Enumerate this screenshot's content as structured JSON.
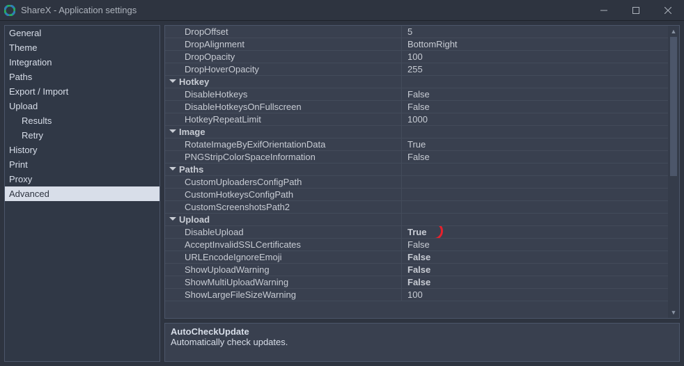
{
  "window": {
    "title": "ShareX - Application settings"
  },
  "sidebar": {
    "items": [
      {
        "label": "General",
        "indent": false
      },
      {
        "label": "Theme",
        "indent": false
      },
      {
        "label": "Integration",
        "indent": false
      },
      {
        "label": "Paths",
        "indent": false
      },
      {
        "label": "Export / Import",
        "indent": false
      },
      {
        "label": "Upload",
        "indent": false
      },
      {
        "label": "Results",
        "indent": true
      },
      {
        "label": "Retry",
        "indent": true
      },
      {
        "label": "History",
        "indent": false
      },
      {
        "label": "Print",
        "indent": false
      },
      {
        "label": "Proxy",
        "indent": false
      },
      {
        "label": "Advanced",
        "indent": false,
        "selected": true
      }
    ]
  },
  "grid": {
    "rows": [
      {
        "type": "prop",
        "name": "DropOffset",
        "value": "5"
      },
      {
        "type": "prop",
        "name": "DropAlignment",
        "value": "BottomRight"
      },
      {
        "type": "prop",
        "name": "DropOpacity",
        "value": "100"
      },
      {
        "type": "prop",
        "name": "DropHoverOpacity",
        "value": "255"
      },
      {
        "type": "cat",
        "name": "Hotkey"
      },
      {
        "type": "prop",
        "name": "DisableHotkeys",
        "value": "False"
      },
      {
        "type": "prop",
        "name": "DisableHotkeysOnFullscreen",
        "value": "False"
      },
      {
        "type": "prop",
        "name": "HotkeyRepeatLimit",
        "value": "1000"
      },
      {
        "type": "cat",
        "name": "Image"
      },
      {
        "type": "prop",
        "name": "RotateImageByExifOrientationData",
        "value": "True"
      },
      {
        "type": "prop",
        "name": "PNGStripColorSpaceInformation",
        "value": "False"
      },
      {
        "type": "cat",
        "name": "Paths"
      },
      {
        "type": "prop",
        "name": "CustomUploadersConfigPath",
        "value": ""
      },
      {
        "type": "prop",
        "name": "CustomHotkeysConfigPath",
        "value": ""
      },
      {
        "type": "prop",
        "name": "CustomScreenshotsPath2",
        "value": ""
      },
      {
        "type": "cat",
        "name": "Upload"
      },
      {
        "type": "prop",
        "name": "DisableUpload",
        "value": "True",
        "vbold": true,
        "annot": true
      },
      {
        "type": "prop",
        "name": "AcceptInvalidSSLCertificates",
        "value": "False"
      },
      {
        "type": "prop",
        "name": "URLEncodeIgnoreEmoji",
        "value": "False",
        "vbold": true
      },
      {
        "type": "prop",
        "name": "ShowUploadWarning",
        "value": "False",
        "vbold": true
      },
      {
        "type": "prop",
        "name": "ShowMultiUploadWarning",
        "value": "False",
        "vbold": true
      },
      {
        "type": "prop",
        "name": "ShowLargeFileSizeWarning",
        "value": "100"
      }
    ]
  },
  "description": {
    "title": "AutoCheckUpdate",
    "body": "Automatically check updates."
  }
}
